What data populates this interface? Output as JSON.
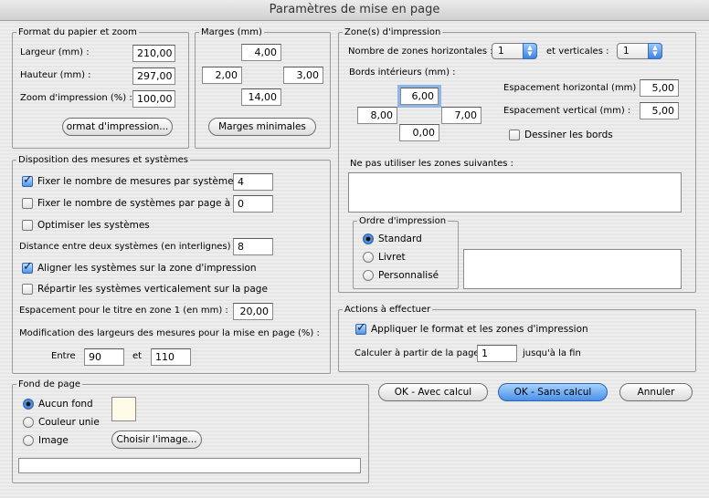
{
  "window": {
    "title": "Paramètres de mise en page"
  },
  "format": {
    "legend": "Format du papier et zoom",
    "width_label": "Largeur (mm) :",
    "width_value": "210,00",
    "height_label": "Hauteur (mm) :",
    "height_value": "297,00",
    "zoom_label": "Zoom d'impression (%) :",
    "zoom_value": "100,00",
    "button_label": "ormat d'impression..."
  },
  "margins": {
    "legend": "Marges (mm)",
    "top": "4,00",
    "left": "2,00",
    "right": "3,00",
    "bottom": "14,00",
    "button_label": "Marges minimales"
  },
  "zones": {
    "legend": "Zone(s) d'impression",
    "horizontal_label": "Nombre de zones horizontales :",
    "horizontal_value": "1",
    "vertical_label": "et verticales :",
    "vertical_value": "1",
    "inner_label": "Bords intérieurs (mm) :",
    "inner_top": "6,00",
    "inner_left": "8,00",
    "inner_right": "7,00",
    "inner_bottom": "0,00",
    "h_spacing_label": "Espacement horizontal (mm) :",
    "h_spacing_value": "5,00",
    "v_spacing_label": "Espacement vertical (mm) :",
    "v_spacing_value": "5,00",
    "draw_borders_label": "Dessiner les bords",
    "exclude_label": "Ne pas utiliser les zones suivantes :",
    "order_legend": "Ordre d'impression",
    "order_standard": "Standard",
    "order_booklet": "Livret",
    "order_custom": "Personnalisé"
  },
  "layout": {
    "legend": "Disposition des mesures et systèmes",
    "fix_measures_label": "Fixer le nombre de mesures par système à :",
    "fix_measures_value": "4",
    "fix_systems_label": "Fixer le nombre de systèmes par page à :",
    "fix_systems_value": "0",
    "optimize_label": "Optimiser les systèmes",
    "distance_label": "Distance entre deux systèmes (en interlignes) :",
    "distance_value": "8",
    "align_label": "Aligner les systèmes sur la zone d'impression",
    "spread_label": "Répartir les systèmes verticalement sur la page",
    "title_spacing_label": "Espacement pour le titre en zone 1 (en mm) :",
    "title_spacing_value": "20,00",
    "width_mod_label": "Modification des largeurs des mesures pour la mise en page (%) :",
    "between_label": "Entre",
    "between_value": "90",
    "and_label": "et",
    "and_value": "110"
  },
  "actions": {
    "legend": "Actions à effectuer",
    "apply_label": "Appliquer le format et les zones d'impression",
    "calc_from_label": "Calculer à partir de la page",
    "calc_from_value": "1",
    "calc_to_label": "jusqu'à la fin"
  },
  "background": {
    "legend": "Fond de page",
    "none_label": "Aucun fond",
    "color_label": "Couleur unie",
    "image_label": "Image",
    "choose_image_label": "Choisir l'image...",
    "swatch_color": "#fffbe6"
  },
  "buttons": {
    "ok_calc": "OK - Avec calcul",
    "ok_no_calc": "OK - Sans calcul",
    "cancel": "Annuler"
  }
}
